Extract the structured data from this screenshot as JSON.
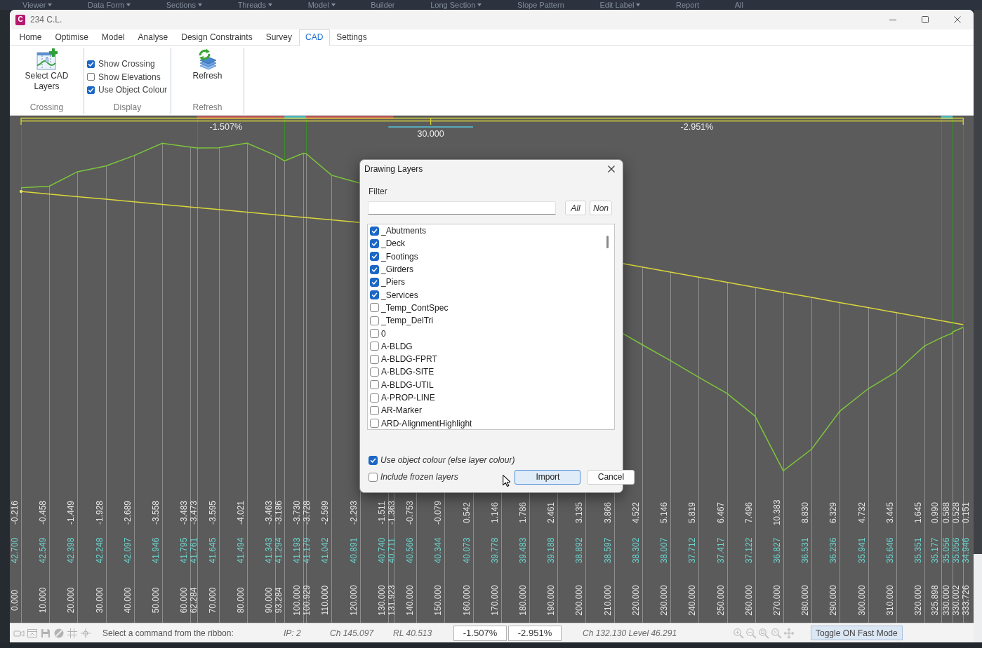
{
  "background_toolbar": [
    {
      "label": "Viewer",
      "dropdown": true
    },
    {
      "label": "Data Form",
      "dropdown": true
    },
    {
      "label": "Sections",
      "dropdown": true
    },
    {
      "label": "Threads",
      "dropdown": true
    },
    {
      "label": "Model",
      "dropdown": true
    },
    {
      "label": "Builder",
      "dropdown": false
    },
    {
      "label": "Long Section",
      "dropdown": true
    },
    {
      "label": "Slope Pattern",
      "dropdown": false
    },
    {
      "label": "Edit Label",
      "dropdown": true
    },
    {
      "label": "Report",
      "dropdown": false
    },
    {
      "label": "All",
      "dropdown": false
    }
  ],
  "window": {
    "app_logo": "C",
    "title": "234 C.L."
  },
  "tabs": [
    {
      "label": "Home",
      "selected": false
    },
    {
      "label": "Optimise",
      "selected": false
    },
    {
      "label": "Model",
      "selected": false
    },
    {
      "label": "Analyse",
      "selected": false
    },
    {
      "label": "Design Constraints",
      "selected": false
    },
    {
      "label": "Survey",
      "selected": false
    },
    {
      "label": "CAD",
      "selected": true
    },
    {
      "label": "Settings",
      "selected": false
    }
  ],
  "ribbon": {
    "groups": [
      {
        "kind": "button",
        "label": "Crossing",
        "button": {
          "label": "Select CAD Layers"
        }
      },
      {
        "kind": "checkboxes",
        "label": "Display",
        "checkboxes": [
          {
            "label": "Show Crossing",
            "checked": true
          },
          {
            "label": "Show Elevations",
            "checked": false
          },
          {
            "label": "Use Object Colour",
            "checked": true
          }
        ]
      },
      {
        "kind": "button",
        "label": "Refresh",
        "button": {
          "label": "Refresh"
        }
      }
    ]
  },
  "profile": {
    "grades": [
      "-1.507%",
      "-2.951%"
    ],
    "vertical_curve_length": "30.000",
    "stations": [
      {
        "chainage": "0.000",
        "design_level": "42.700",
        "difference": "-0.216"
      },
      {
        "chainage": "10.000",
        "design_level": "42.549",
        "difference": "-0.458"
      },
      {
        "chainage": "20.000",
        "design_level": "42.398",
        "difference": "-1.449"
      },
      {
        "chainage": "30.000",
        "design_level": "42.248",
        "difference": "-1.928"
      },
      {
        "chainage": "40.000",
        "design_level": "42.097",
        "difference": "-2.689"
      },
      {
        "chainage": "50.000",
        "design_level": "41.946",
        "difference": "-3.558"
      },
      {
        "chainage": "60.000",
        "design_level": "41.795",
        "difference": "-3.483"
      },
      {
        "chainage": "62.284",
        "design_level": "41.761",
        "difference": "-3.473"
      },
      {
        "chainage": "70.000",
        "design_level": "41.645",
        "difference": "-3.595"
      },
      {
        "chainage": "80.000",
        "design_level": "41.494",
        "difference": "-4.021"
      },
      {
        "chainage": "90.000",
        "design_level": "41.343",
        "difference": "-3.463"
      },
      {
        "chainage": "93.284",
        "design_level": "41.294",
        "difference": "-3.186"
      },
      {
        "chainage": "100.000",
        "design_level": "41.193",
        "difference": "-3.730"
      },
      {
        "chainage": "100.929",
        "design_level": "41.179",
        "difference": "-3.728"
      },
      {
        "chainage": "110.000",
        "design_level": "41.042",
        "difference": "-2.599"
      },
      {
        "chainage": "120.000",
        "design_level": "40.891",
        "difference": "-2.293"
      },
      {
        "chainage": "130.000",
        "design_level": "40.740",
        "difference": "-1.511"
      },
      {
        "chainage": "131.923",
        "design_level": "40.711",
        "difference": "-1.363"
      },
      {
        "chainage": "140.000",
        "design_level": "40.566",
        "difference": "-0.753"
      },
      {
        "chainage": "150.000",
        "design_level": "40.344",
        "difference": "-0.079"
      },
      {
        "chainage": "160.000",
        "design_level": "40.073",
        "difference": "0.542"
      },
      {
        "chainage": "170.000",
        "design_level": "39.778",
        "difference": "1.146"
      },
      {
        "chainage": "180.000",
        "design_level": "39.483",
        "difference": "1.786"
      },
      {
        "chainage": "190.000",
        "design_level": "39.188",
        "difference": "2.461"
      },
      {
        "chainage": "200.000",
        "design_level": "38.892",
        "difference": "3.135"
      },
      {
        "chainage": "210.000",
        "design_level": "38.597",
        "difference": "3.866"
      },
      {
        "chainage": "220.000",
        "design_level": "38.302",
        "difference": "4.522"
      },
      {
        "chainage": "230.000",
        "design_level": "38.007",
        "difference": "5.146"
      },
      {
        "chainage": "240.000",
        "design_level": "37.712",
        "difference": "5.819"
      },
      {
        "chainage": "250.000",
        "design_level": "37.417",
        "difference": "6.467"
      },
      {
        "chainage": "260.000",
        "design_level": "37.122",
        "difference": "7.496"
      },
      {
        "chainage": "270.000",
        "design_level": "36.827",
        "difference": "10.383"
      },
      {
        "chainage": "280.000",
        "design_level": "36.531",
        "difference": "8.830"
      },
      {
        "chainage": "290.000",
        "design_level": "36.236",
        "difference": "6.329"
      },
      {
        "chainage": "300.000",
        "design_level": "35.941",
        "difference": "4.732"
      },
      {
        "chainage": "310.000",
        "design_level": "35.646",
        "difference": "3.445"
      },
      {
        "chainage": "320.000",
        "design_level": "35.351",
        "difference": "1.645"
      },
      {
        "chainage": "325.898",
        "design_level": "35.177",
        "difference": "0.990"
      },
      {
        "chainage": "330.000",
        "design_level": "35.056",
        "difference": "0.588"
      },
      {
        "chainage": "330.002",
        "design_level": "35.056",
        "difference": "0.528"
      },
      {
        "chainage": "333.726",
        "design_level": "34.946",
        "difference": "0.151"
      }
    ]
  },
  "dialog": {
    "title": "Drawing Layers",
    "filter_label": "Filter",
    "filter_buttons": [
      "All",
      "Non"
    ],
    "layers": [
      {
        "name": "_Abutments",
        "checked": true
      },
      {
        "name": "_Deck",
        "checked": true
      },
      {
        "name": "_Footings",
        "checked": true
      },
      {
        "name": "_Girders",
        "checked": true
      },
      {
        "name": "_Piers",
        "checked": true
      },
      {
        "name": "_Services",
        "checked": true
      },
      {
        "name": "_Temp_ContSpec",
        "checked": false
      },
      {
        "name": "_Temp_DelTri",
        "checked": false
      },
      {
        "name": "0",
        "checked": false
      },
      {
        "name": "A-BLDG",
        "checked": false
      },
      {
        "name": "A-BLDG-FPRT",
        "checked": false
      },
      {
        "name": "A-BLDG-SITE",
        "checked": false
      },
      {
        "name": "A-BLDG-UTIL",
        "checked": false
      },
      {
        "name": "A-PROP-LINE",
        "checked": false
      },
      {
        "name": "AR-Marker",
        "checked": false
      },
      {
        "name": "ARD-AlignmentHighlight",
        "checked": false
      }
    ],
    "options": [
      {
        "label": "Use object colour (else layer colour)",
        "checked": true
      },
      {
        "label": "Include frozen layers",
        "checked": false
      }
    ],
    "buttons": [
      {
        "label": "Import",
        "focused": true
      },
      {
        "label": "Cancel",
        "focused": false
      }
    ]
  },
  "status_bar": {
    "prompt": "Select a command from the ribbon:",
    "ip": "IP: 2",
    "chainage": "Ch 145.097",
    "level": "RL 40.513",
    "grades": [
      "-1.507%",
      "-2.951%"
    ],
    "cursor": "Ch 132.130 Level 46.291",
    "fast_mode_button": "Toggle ON Fast Mode"
  }
}
